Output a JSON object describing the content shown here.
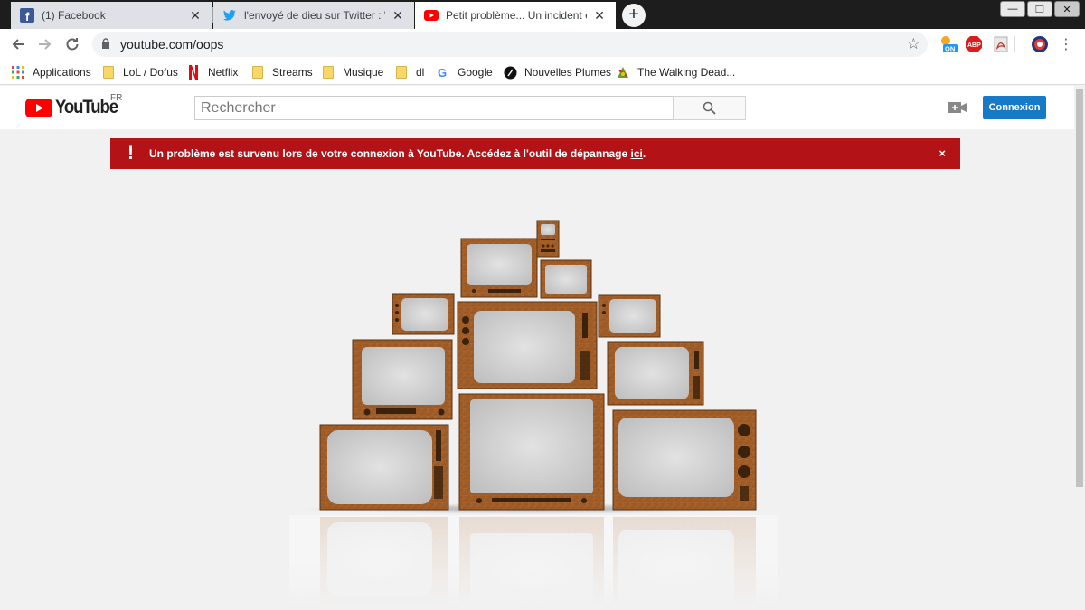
{
  "tabs": [
    {
      "title": "(1) Facebook",
      "icon": "facebook-icon",
      "active": false
    },
    {
      "title": "l'envoyé de dieu sur Twitter : \"@",
      "icon": "twitter-icon",
      "active": false
    },
    {
      "title": "Petit problème... Un incident est",
      "icon": "youtube-icon",
      "active": true
    }
  ],
  "new_tab_label": "+",
  "window_controls": {
    "minimize": "—",
    "maximize": "❐",
    "close": "✕"
  },
  "address_bar": {
    "url": "youtube.com/oops"
  },
  "bookmarks": [
    {
      "label": "Applications",
      "icon": "apps-grid-icon"
    },
    {
      "label": "LoL / Dofus",
      "icon": "folder-icon"
    },
    {
      "label": "Netflix",
      "icon": "netflix-icon"
    },
    {
      "label": "Streams",
      "icon": "folder-icon"
    },
    {
      "label": "Musique",
      "icon": "folder-icon"
    },
    {
      "label": "dl",
      "icon": "folder-icon"
    },
    {
      "label": "Google",
      "icon": "google-icon"
    },
    {
      "label": "Nouvelles Plumes",
      "icon": "nouvelles-plumes-icon"
    },
    {
      "label": "The Walking Dead...",
      "icon": "walking-dead-icon"
    }
  ],
  "extensions": {
    "weather_badge": "ON",
    "adblock": "ABP"
  },
  "youtube": {
    "logo_text": "YouTube",
    "country_code": "FR",
    "search_placeholder": "Rechercher",
    "sign_in_label": "Connexion"
  },
  "alert": {
    "icon_text": "!",
    "message": "Un problème est survenu lors de votre connexion à YouTube. Accédez à l'outil de dépannage ",
    "link_text": "ici",
    "suffix": ".",
    "close_text": "×"
  },
  "colors": {
    "youtube_red": "#ff0000",
    "alert_red": "#b31217",
    "signin_blue": "#167ac6",
    "tv_wood": "#a2602a",
    "screen_gray": "#d4d4d4"
  }
}
